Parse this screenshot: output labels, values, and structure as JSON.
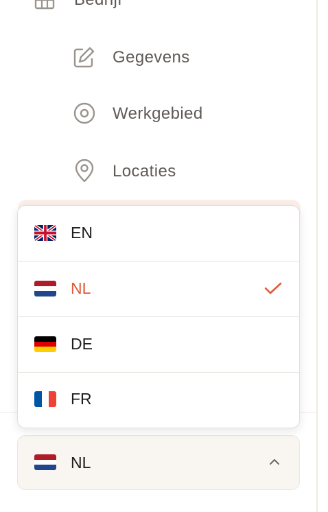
{
  "nav": {
    "parent": {
      "label": "Bedrijf",
      "icon": "building-icon"
    },
    "items": [
      {
        "label": "Gegevens",
        "icon": "edit-icon"
      },
      {
        "label": "Werkgebied",
        "icon": "target-icon"
      },
      {
        "label": "Locaties",
        "icon": "map-pin-icon"
      }
    ]
  },
  "language_menu": {
    "options": [
      {
        "code": "EN",
        "flag": "uk-flag-icon",
        "selected": false
      },
      {
        "code": "NL",
        "flag": "nl-flag-icon",
        "selected": true
      },
      {
        "code": "DE",
        "flag": "de-flag-icon",
        "selected": false
      },
      {
        "code": "FR",
        "flag": "fr-flag-icon",
        "selected": false
      }
    ],
    "current": {
      "code": "NL",
      "flag": "nl-flag-icon"
    }
  },
  "colors": {
    "accent": "#e05a35",
    "nav_text": "#5f5a55",
    "select_bg": "#f9f5f0"
  }
}
